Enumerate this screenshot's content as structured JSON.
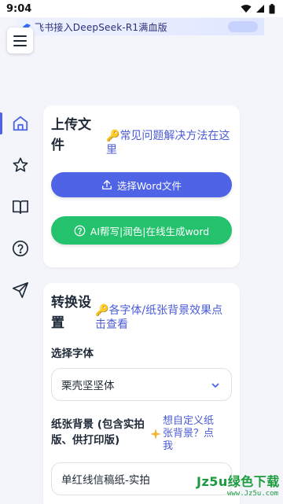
{
  "status_bar": {
    "time": "9:04"
  },
  "banner": {
    "text": "飞书接入DeepSeek-R1满血版"
  },
  "sidebar": {
    "items": [
      {
        "icon": "home-icon",
        "active": true
      },
      {
        "icon": "star-icon",
        "active": false
      },
      {
        "icon": "book-icon",
        "active": false
      },
      {
        "icon": "help-circle-icon",
        "active": false
      },
      {
        "icon": "send-icon",
        "active": false
      }
    ]
  },
  "upload_card": {
    "title": "上传文件",
    "help_link": "常见问题解决方法在这里",
    "upload_button": "选择Word文件",
    "ai_button": "AI帮写|润色|在线生成word"
  },
  "settings_card": {
    "title": "转换设置",
    "effects_link": "各字体/纸张背景效果点击查看",
    "font_label": "选择字体",
    "font_value": "栗壳坚坚体",
    "paper_label": "纸张背景 (包含实拍版、供打印版)",
    "custom_bg_link": "想自定义纸张背景？点我",
    "paper_value": "单红线信稿纸-实拍"
  },
  "watermark": {
    "brand": "Jz5u绿色下载",
    "url": "www.Jz5u.com"
  },
  "colors": {
    "primary": "#4f63e7",
    "success": "#25c26e",
    "link": "#4a5bd6"
  }
}
